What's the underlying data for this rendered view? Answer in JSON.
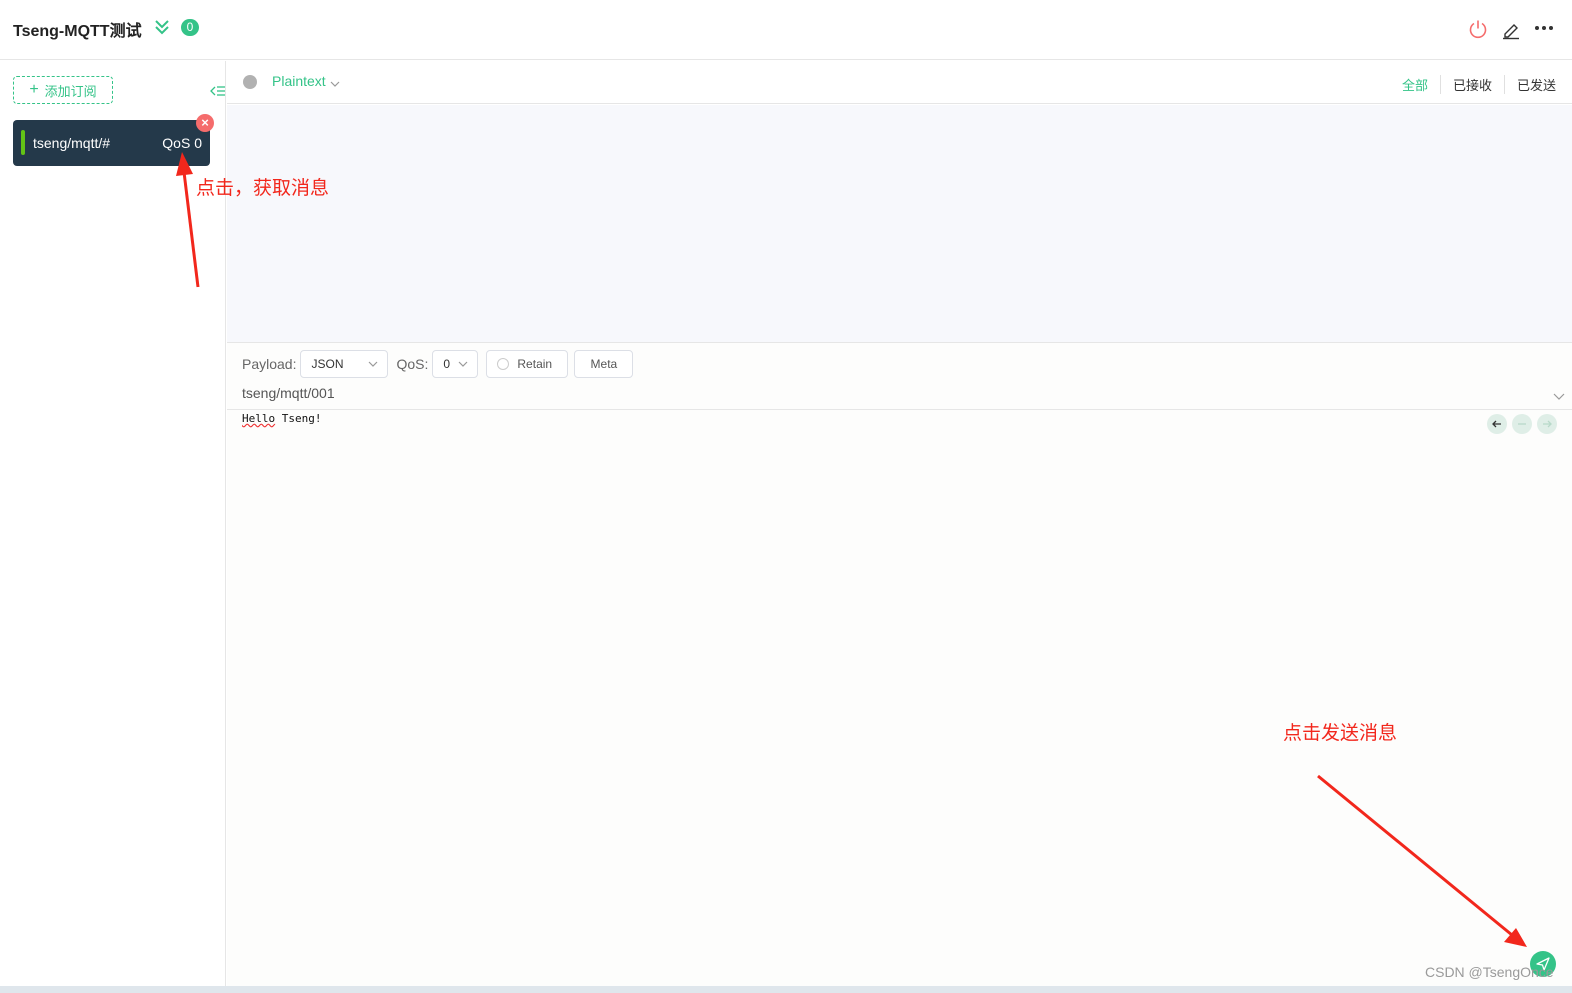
{
  "header": {
    "title": "Tseng-MQTT测试",
    "count": "0",
    "colors": {
      "accent": "#34c388",
      "power": "#f56c6c"
    }
  },
  "sidebar": {
    "add_subscription_label": "添加订阅",
    "subscriptions": [
      {
        "topic": "tseng/mqtt/#",
        "qos": "QoS 0",
        "color": "#63c316"
      }
    ]
  },
  "message_bar": {
    "format": "Plaintext",
    "filters": [
      "全部",
      "已接收",
      "已发送"
    ]
  },
  "publish": {
    "payload_label": "Payload:",
    "payload_type": "JSON",
    "qos_label": "QoS:",
    "qos_value": "0",
    "retain_label": "Retain",
    "meta_label": "Meta",
    "topic": "tseng/mqtt/001",
    "payload_word1": "Hello",
    "payload_word2": " Tseng!"
  },
  "annotations": {
    "note_subscribe": "点击，获取消息",
    "note_send": "点击发送消息"
  },
  "watermark": "CSDN @TsengOnce"
}
